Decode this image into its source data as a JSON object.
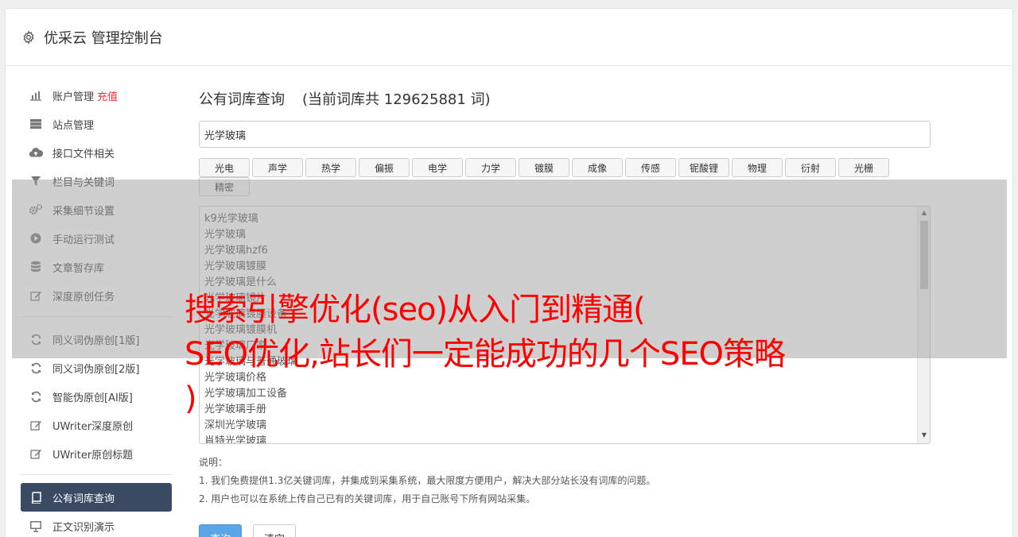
{
  "header": {
    "title": "优采云 管理控制台"
  },
  "sidebar": {
    "group1": [
      {
        "label": "账户管理",
        "badge": "充值",
        "icon": "bar-chart-icon"
      },
      {
        "label": "站点管理",
        "icon": "server-icon"
      },
      {
        "label": "接口文件相关",
        "icon": "cloud-upload-icon"
      },
      {
        "label": "栏目与关键词",
        "icon": "filter-icon"
      },
      {
        "label": "采集细节设置",
        "icon": "gears-icon"
      },
      {
        "label": "手动运行测试",
        "icon": "play-icon"
      },
      {
        "label": "文章暂存库",
        "icon": "database-icon"
      },
      {
        "label": "深度原创任务",
        "icon": "edit-icon"
      }
    ],
    "group2": [
      {
        "label": "同义词伪原创[1版]",
        "icon": "refresh-icon"
      },
      {
        "label": "同义词伪原创[2版]",
        "icon": "refresh-icon"
      },
      {
        "label": "智能伪原创[AI版]",
        "icon": "refresh-icon"
      },
      {
        "label": "UWriter深度原创",
        "icon": "edit-icon"
      },
      {
        "label": "UWriter原创标题",
        "icon": "edit-icon"
      }
    ],
    "group3": [
      {
        "label": "公有词库查询",
        "icon": "book-icon"
      },
      {
        "label": "正文识别演示",
        "icon": "monitor-icon"
      }
    ]
  },
  "main": {
    "title": "公有词库查询",
    "count_text": "(当前词库共 129625881 词)",
    "search_value": "光学玻璃",
    "tags": [
      "光电",
      "声学",
      "热学",
      "偏振",
      "电学",
      "力学",
      "镀膜",
      "成像",
      "传感",
      "铌酸锂",
      "物理",
      "衍射",
      "光栅",
      "精密"
    ],
    "results": [
      "k9光学玻璃",
      "光学玻璃",
      "光学玻璃hzf6",
      "光学玻璃镀膜",
      "光学玻璃是什么",
      "光学玻璃镜片",
      "光学玻璃镀膜设备",
      "光学玻璃镀膜机",
      "光学玻璃厂家",
      "光学玻璃与普通玻璃",
      "光学玻璃价格",
      "光学玻璃加工设备",
      "光学玻璃手册",
      "深圳光学玻璃",
      "肖特光学玻璃"
    ],
    "notes": {
      "heading": "说明：",
      "line1": "1. 我们免费提供1.3亿关键词库，并集成到采集系统，最大限度方便用户，解决大部分站长没有词库的问题。",
      "line2": "2. 用户也可以在系统上传自己已有的关键词库，用于自己账号下所有网站采集。"
    },
    "query_button": "查询",
    "clear_button": "清空"
  },
  "overlay": {
    "line1": "搜索引擎优化(seo)从入门到精通(",
    "line2": "SEO优化,站长们一定能成功的几个SEO策略",
    "line3": ")"
  },
  "colors": {
    "active_nav": "#3a4a62",
    "primary": "#5aa4e8",
    "overlay_text": "#ff0000",
    "badge": "#ee3333"
  }
}
